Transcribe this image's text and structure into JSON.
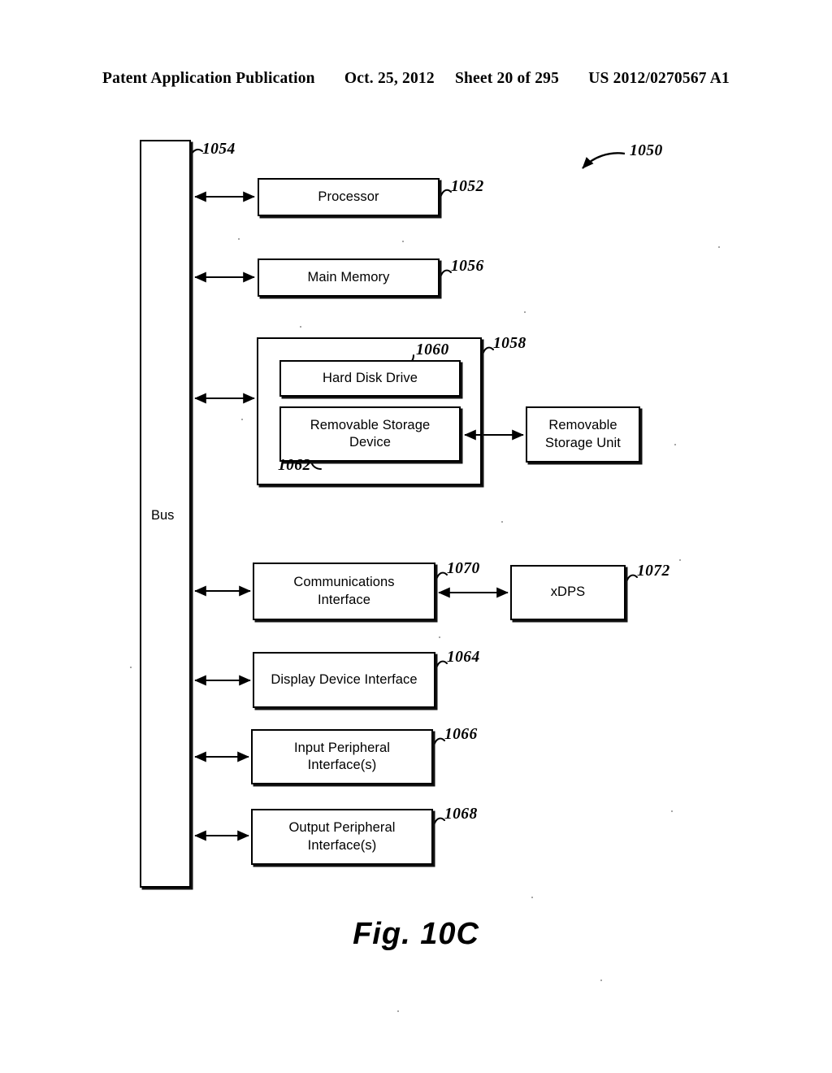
{
  "header": {
    "publication": "Patent Application Publication",
    "date": "Oct. 25, 2012",
    "sheet": "Sheet 20 of 295",
    "patent_number": "US 2012/0270567 A1"
  },
  "figure": {
    "caption": "Fig. 10C",
    "system_ref": "1050"
  },
  "bus": {
    "label": "Bus",
    "ref": "1054"
  },
  "nodes": {
    "processor": {
      "label": "Processor",
      "ref": "1052"
    },
    "main_memory": {
      "label": "Main Memory",
      "ref": "1056"
    },
    "secondary_storage": {
      "label": "",
      "ref": "1058"
    },
    "hard_disk_drive": {
      "label": "Hard Disk Drive",
      "ref": "1060"
    },
    "removable_storage_device": {
      "label": "Removable Storage Device",
      "ref": "1062"
    },
    "removable_storage_unit": {
      "label": "Removable Storage Unit",
      "ref": ""
    },
    "communications_interface": {
      "label": "Communications Interface",
      "ref": "1070"
    },
    "xdps": {
      "label": "xDPS",
      "ref": "1072"
    },
    "display_device_interface": {
      "label": "Display Device Interface",
      "ref": "1064"
    },
    "input_peripheral_interface": {
      "label": "Input Peripheral Interface(s)",
      "ref": "1066"
    },
    "output_peripheral_interface": {
      "label": "Output Peripheral Interface(s)",
      "ref": "1068"
    }
  },
  "colors": {
    "ink": "#000000",
    "paper": "#ffffff"
  }
}
